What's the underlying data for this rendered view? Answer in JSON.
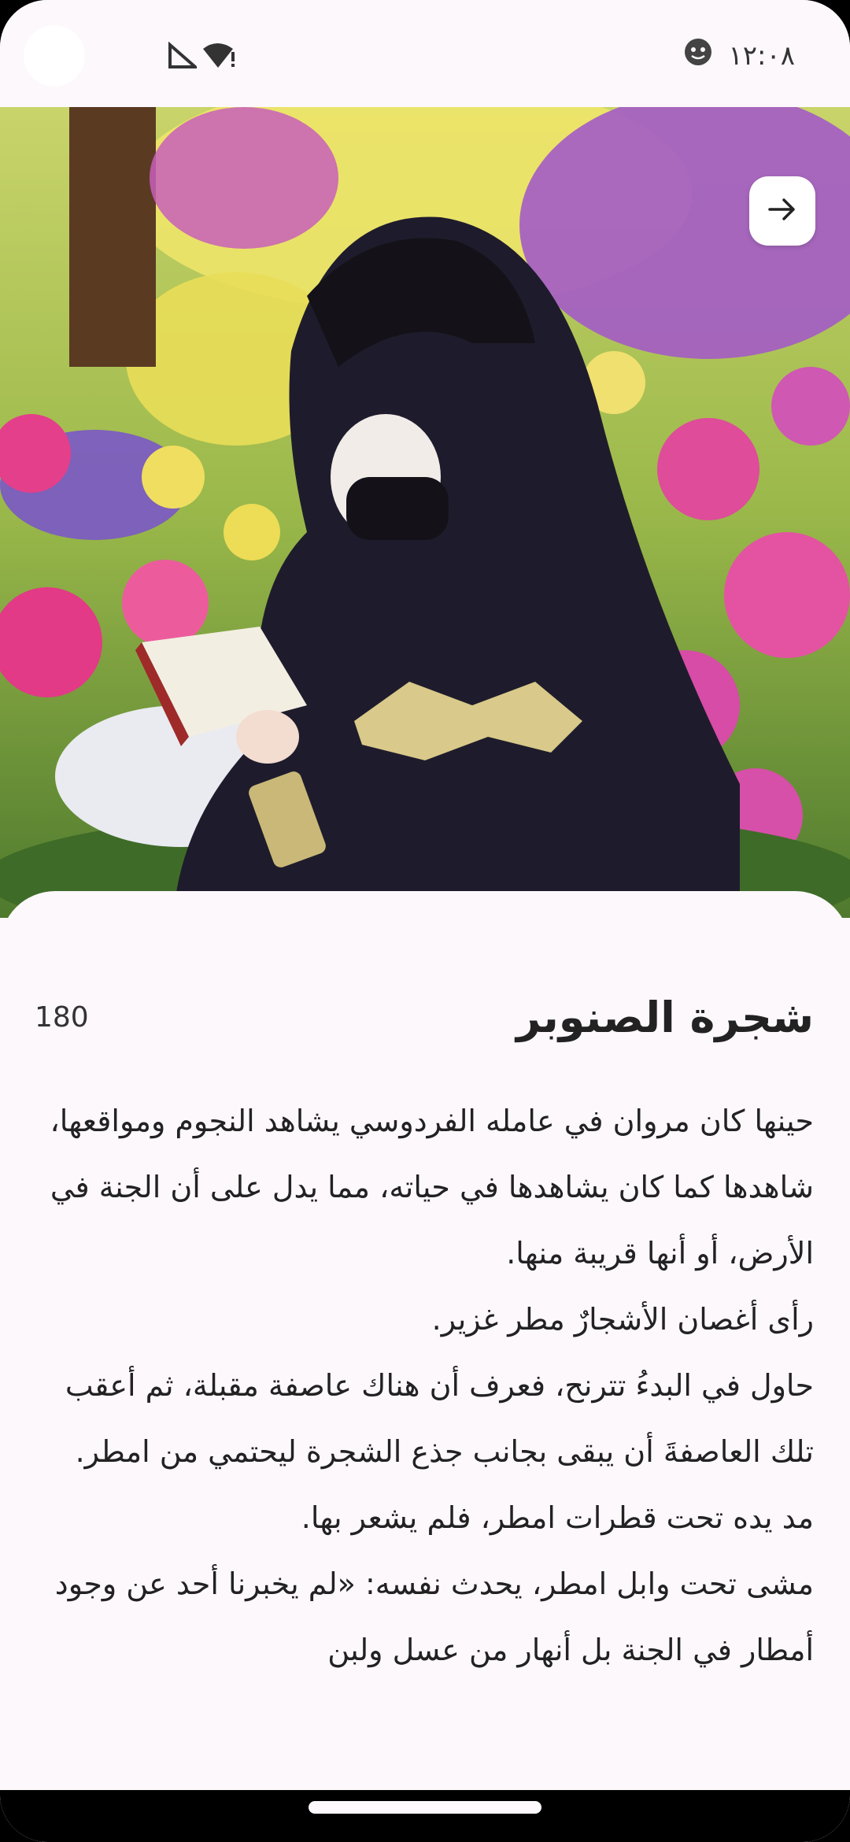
{
  "status_bar": {
    "time": "١٢:٠٨",
    "icons": [
      "face-icon",
      "signal-icon",
      "wifi-alert-icon"
    ]
  },
  "header": {
    "back_icon": "arrow-right-icon"
  },
  "story": {
    "title": "شجرة الصنوبر",
    "count": "180",
    "paragraphs": [
      "حينها كان مروان في عامله الفردوسي يشاهد النجوم ومواقعها، شاهدها كما كان يشاهدها في حياته، مما يدل على أن الجنة في الأرض، أو أنها قريبة منها.",
      "رأى أغصان الأشجارٌ مطر غزير.",
      "حاول في البدءُ تترنح، فعرف أن هناك عاصفة مقبلة، ثم أعقب تلك العاصفةَ أن يبقى بجانب جذع الشجرة ليحتمي من امطر.",
      "مد يده تحت قطرات امطر، فلم يشعر بها.",
      "مشى تحت وابل امطر، يحدث نفسه: «لم يخبرنا أحد عن وجود أمطار في الجنة بل أنهار من عسل ولبن"
    ]
  },
  "colors": {
    "background": "#fdf8fc",
    "text": "#222222"
  }
}
